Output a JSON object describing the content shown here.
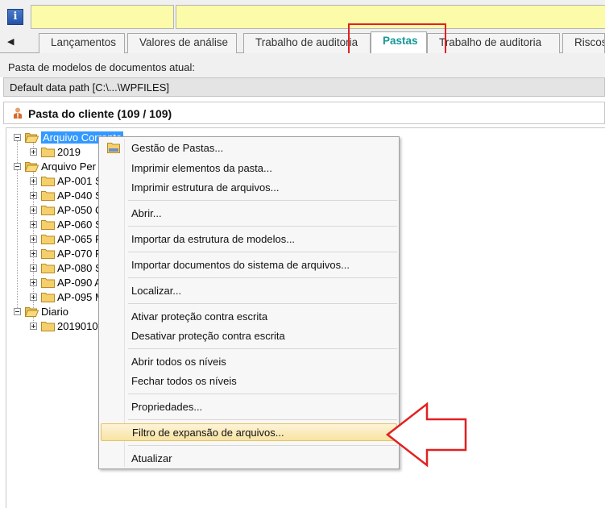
{
  "toolbar": {
    "info_icon": "info-icon",
    "info_glyph": "i"
  },
  "tabs": [
    {
      "label": "Lançamentos",
      "active": false
    },
    {
      "label": "Valores de análise",
      "active": false
    },
    {
      "label": "Trabalho de auditoria",
      "active": false
    },
    {
      "label": "Pastas",
      "active": true
    },
    {
      "label": "Trabalho de auditoria",
      "active": false
    },
    {
      "label": "Riscos",
      "active": false
    }
  ],
  "templates": {
    "label": "Pasta de modelos de documentos atual:",
    "path": "Default data path [C:\\...\\WPFILES]"
  },
  "client_panel": {
    "title": "Pasta do cliente (109 / 109)"
  },
  "tree": {
    "nodes": [
      {
        "label": "Arquivo Corrente",
        "selected": true
      },
      {
        "label": "2019"
      },
      {
        "label": "Arquivo Per"
      },
      {
        "label": "AP-001 S"
      },
      {
        "label": "AP-040 S"
      },
      {
        "label": "AP-050 C"
      },
      {
        "label": "AP-060 S"
      },
      {
        "label": "AP-065 F"
      },
      {
        "label": "AP-070 F"
      },
      {
        "label": "AP-080 S"
      },
      {
        "label": "AP-090 A"
      },
      {
        "label": "AP-095 M"
      },
      {
        "label": "Diario"
      },
      {
        "label": "20190101"
      }
    ]
  },
  "context_menu": {
    "items": [
      "Gestão de Pastas...",
      "Imprimir elementos da pasta...",
      "Imprimir estrutura de arquivos...",
      "Abrir...",
      "Importar da estrutura de modelos...",
      "Importar documentos do sistema de arquivos...",
      "Localizar...",
      "Ativar proteção contra escrita",
      "Desativar proteção contra escrita",
      "Abrir todos os níveis",
      "Fechar todos os níveis",
      "Propriedades...",
      "Filtro de expansão de arquivos...",
      "Atualizar"
    ],
    "hovered_item": "Filtro de expansão de arquivos..."
  },
  "colors": {
    "active_tab_text": "#149999",
    "selection": "#3399ff",
    "annotation_red": "#e22020",
    "field_yellow": "#fbfbaa"
  }
}
